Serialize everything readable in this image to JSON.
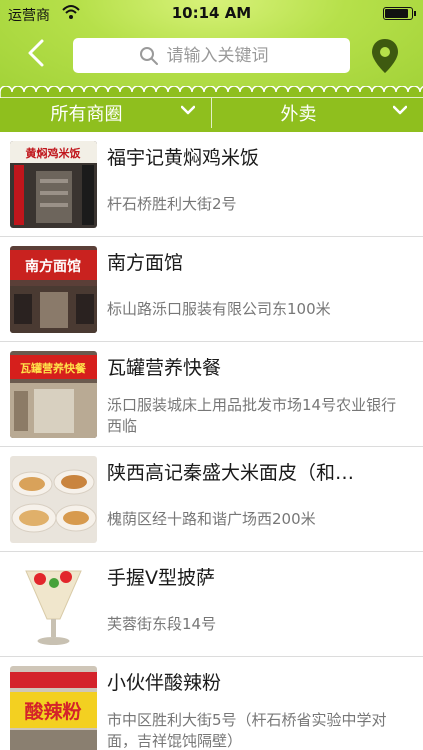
{
  "status_bar": {
    "carrier": "运营商",
    "time": "10:14 AM",
    "battery_level": 0.85
  },
  "search": {
    "placeholder": "请输入关键词"
  },
  "filters": [
    {
      "label": "所有商圈"
    },
    {
      "label": "外卖"
    }
  ],
  "colors": {
    "header_green": "#b6e04a",
    "filter_green": "#8fbf1e",
    "pin_green": "#3e5a10"
  },
  "restaurants": [
    {
      "name": "福宇记黄焖鸡米饭",
      "address": "杆石桥胜利大街2号",
      "sign_text": "黄焖鸡米饭"
    },
    {
      "name": "南方面馆",
      "address": "标山路泺口服装有限公司东100米",
      "sign_text": "南方面馆"
    },
    {
      "name": "瓦罐营养快餐",
      "address": "泺口服装城床上用品批发市场14号农业银行西临",
      "sign_text": "瓦罐营养快餐"
    },
    {
      "name": "陕西高记秦盛大米面皮（和…",
      "address": "槐荫区经十路和谐广场西200米",
      "sign_text": ""
    },
    {
      "name": "手握V型披萨",
      "address": "芙蓉街东段14号",
      "sign_text": ""
    },
    {
      "name": "小伙伴酸辣粉",
      "address": "市中区胜利大街5号（杆石桥省实验中学对面，吉祥馄饨隔壁）",
      "sign_text": "酸辣粉"
    }
  ]
}
